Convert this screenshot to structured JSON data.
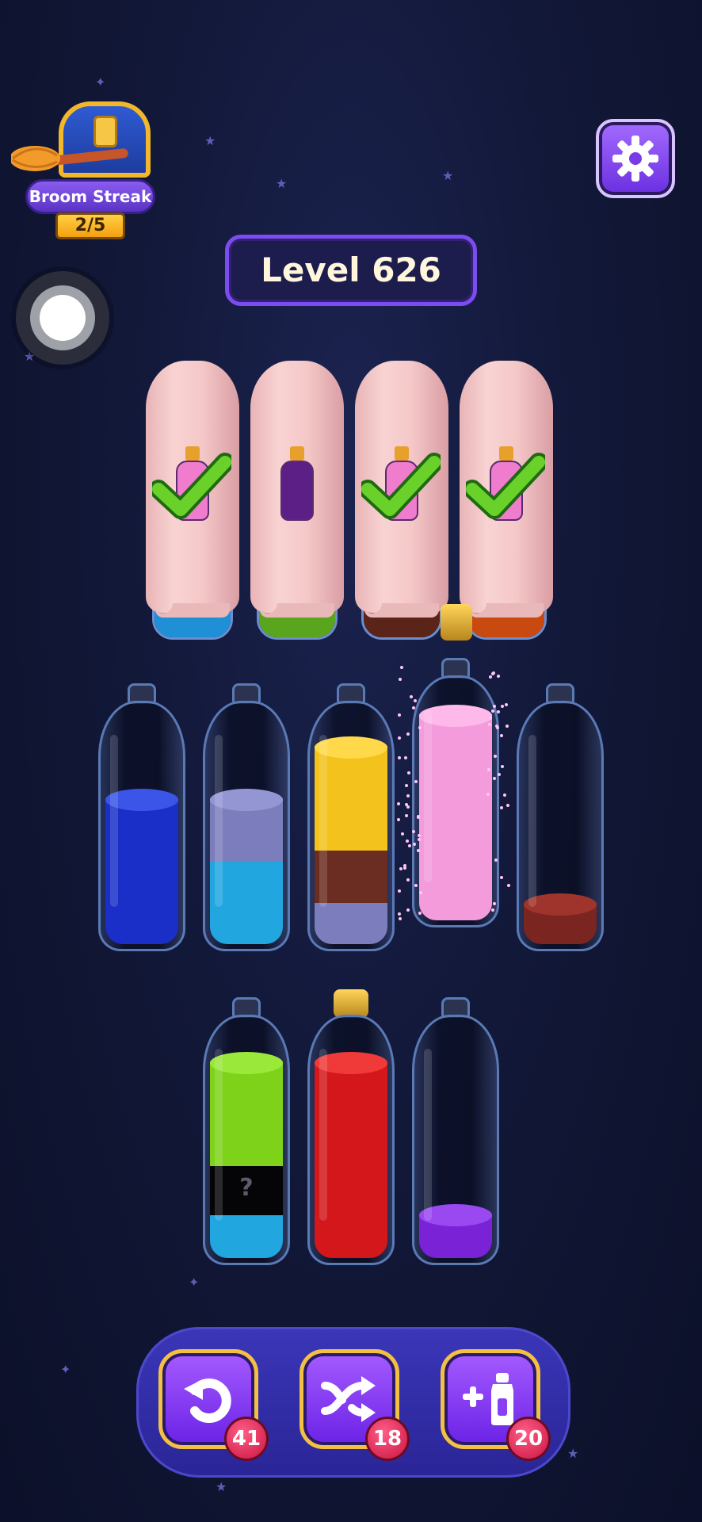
{
  "streak": {
    "title": "Broom Streak",
    "count": "2/5"
  },
  "level": {
    "label": "Level 626"
  },
  "colors": {
    "blue": "#1a2fc8",
    "lavender": "#7b7dbd",
    "sky": "#21a6e0",
    "yellow": "#f3c21c",
    "brown": "#6b2c22",
    "pink": "#f49bdc",
    "darkred": "#7a2520",
    "lime": "#7ed31a",
    "red": "#d4171b",
    "purple": "#7a22d6",
    "mystery": "#050508"
  },
  "covered_bottles": [
    {
      "icon": "check-icon",
      "complete": true,
      "base_color": "#1f8fd6"
    },
    {
      "icon": "mini-potion-icon",
      "complete": false,
      "base_color": "#5aa51e"
    },
    {
      "icon": "check-icon",
      "complete": true,
      "base_color": "#5a2418"
    },
    {
      "icon": "check-icon",
      "complete": true,
      "base_color": "#c84a10"
    }
  ],
  "hidden_layer_label": "?",
  "tools": [
    {
      "name": "undo",
      "icon": "undo-icon",
      "count": "41"
    },
    {
      "name": "shuffle",
      "icon": "shuffle-icon",
      "count": "18"
    },
    {
      "name": "add-bottle",
      "icon": "add-bottle-icon",
      "count": "20"
    }
  ]
}
